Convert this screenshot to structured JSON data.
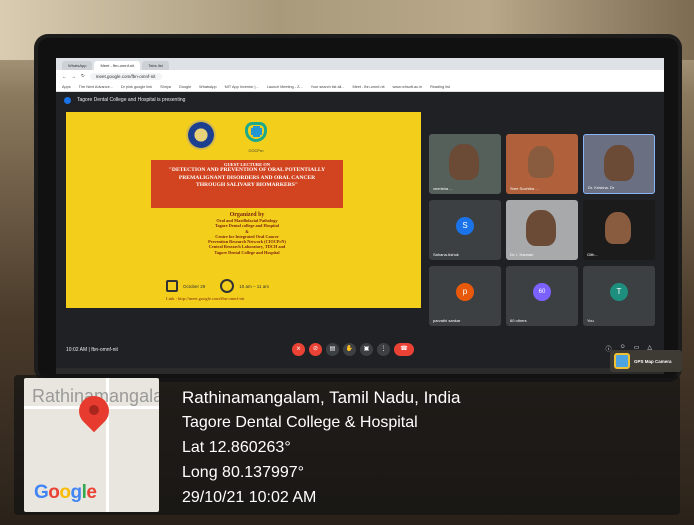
{
  "browser": {
    "tabs": [
      "WhatsApp",
      "Meet - fbn-omnf-nit",
      "Tabs list"
    ],
    "url": "meet.google.com/fbn-omnf-nit",
    "bookmarks": [
      "Apps",
      "The Next Advance...",
      "Dr pink google link",
      "Shriya",
      "Google",
      "WhatsApp",
      "MIT App Inventor |...",
      "Launch Meeting - Z...",
      "Your search list all...",
      "Meet - fbn-omnf-nit",
      "www.rchsoft.ac.in",
      "Reading list"
    ]
  },
  "meet": {
    "presenting_banner": "Tagore Dental College and Hospital is presenting",
    "slide": {
      "logo_caption": "COCFrn",
      "lecture_label": "GUEST LECTURE ON",
      "title_lines": [
        "\"DETECTION AND PREVENTION OF ORAL POTENTIALLY",
        "PREMALIGNANT DISORDERS AND ORAL CANCER",
        "THROUGH SALIVARY BIOMARKERS\""
      ],
      "organized_by": "Organized by",
      "org_lines": [
        "Oral and Maxillofacial Pathology",
        "Tagore Dental college and Hospital",
        "&",
        "Centre for Integrated Oral Cancer",
        "Prevention Research Network (CIOCPrN)",
        "Central Research Laboratory, TDCH and",
        "Tagore Dental College and Hospital"
      ],
      "date": "October 29",
      "time": "10 am – 11 am",
      "link": "Link : http://meet.google.com/fbn-omnf-nit"
    },
    "participants": [
      {
        "name": "veerisha ...",
        "type": "video"
      },
      {
        "name": "Sree Suchitra ...",
        "type": "video"
      },
      {
        "name": "Dr. Krishna. Dr",
        "type": "video"
      },
      {
        "name": "Sahana Ashok",
        "type": "avatar",
        "initial": "S",
        "color": "#1a73e8"
      },
      {
        "name": "Dr. I. Kannan",
        "type": "video"
      },
      {
        "name": "Gith...",
        "type": "video"
      },
      {
        "name": "parvathi sankar",
        "type": "avatar",
        "initial": "p",
        "color": "#e8590c"
      },
      {
        "name": "60 others",
        "type": "avatar",
        "initial": "60",
        "color": "#7b61ff"
      },
      {
        "name": "You",
        "type": "avatar",
        "initial": "T",
        "color": "#1e8e7e"
      }
    ],
    "meeting_info": "10:02 AM | fbn-omnf-nit"
  },
  "gps_camera_label": "GPS Map Camera",
  "map": {
    "place_label": "Rathinamangalam",
    "google_logo": "Google"
  },
  "geo": {
    "location": "Rathinamangalam, Tamil Nadu, India",
    "place": "Tagore Dental College & Hospital",
    "lat": "Lat 12.860263°",
    "long": "Long 80.137997°",
    "datetime": "29/10/21 10:02 AM"
  }
}
